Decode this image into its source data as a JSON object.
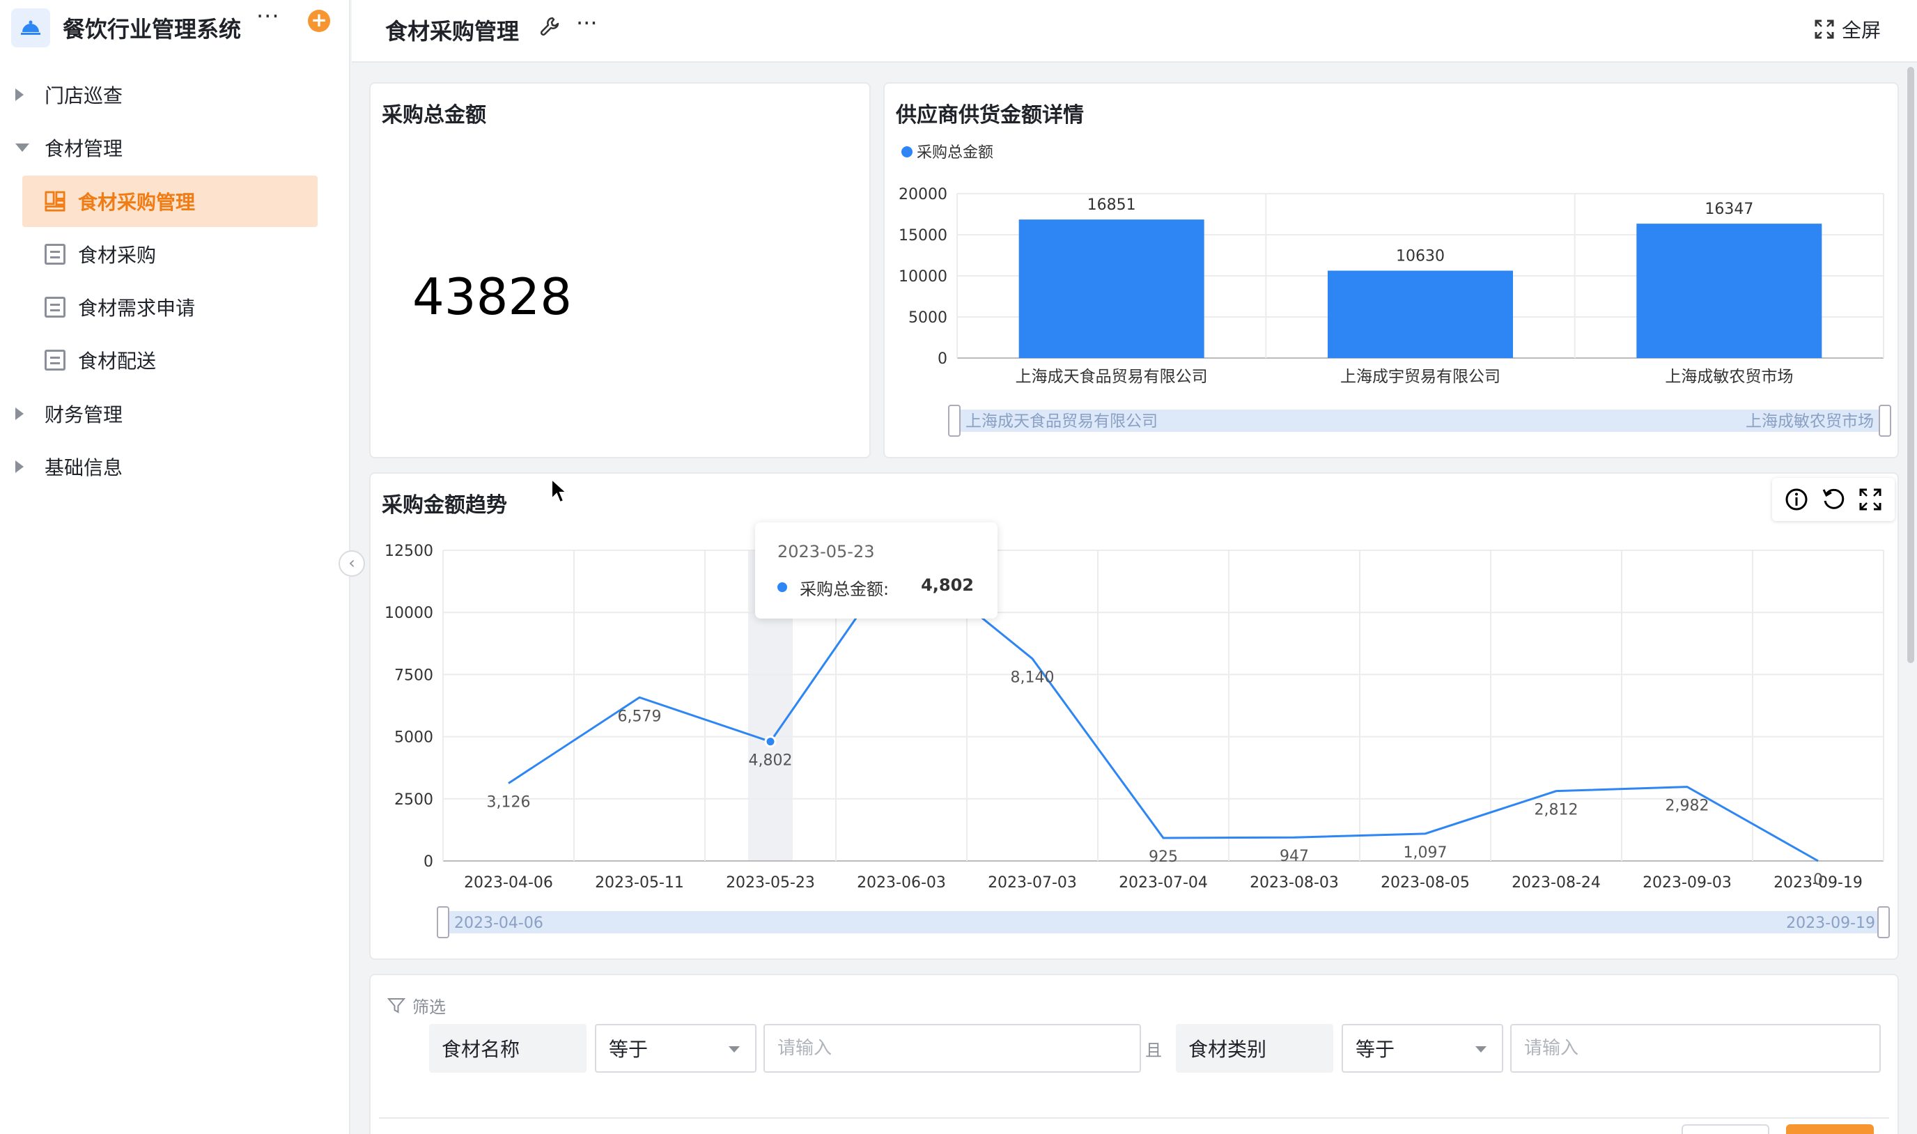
{
  "app": {
    "title": "餐饮行业管理系统",
    "more": "···",
    "add": "+"
  },
  "sidebar": {
    "items": [
      {
        "label": "门店巡查",
        "expanded": false
      },
      {
        "label": "食材管理",
        "expanded": true
      },
      {
        "label": "财务管理",
        "expanded": false
      },
      {
        "label": "基础信息",
        "expanded": false
      }
    ],
    "sub_items": [
      {
        "label": "食材采购管理",
        "active": true
      },
      {
        "label": "食材采购",
        "active": false
      },
      {
        "label": "食材需求申请",
        "active": false
      },
      {
        "label": "食材配送",
        "active": false
      }
    ],
    "collapse": "‹"
  },
  "header": {
    "title": "食材采购管理",
    "more": "···",
    "fullscreen_label": "全屏"
  },
  "total_card": {
    "title": "采购总金额",
    "value": "43828"
  },
  "supplier_card": {
    "title": "供应商供货金额详情"
  },
  "trend_card": {
    "title": "采购金额趋势"
  },
  "tooltip": {
    "date": "2023-05-23",
    "label": "采购总金额:",
    "value": "4,802"
  },
  "filter": {
    "title": "筛选",
    "field1": "食材名称",
    "op1": "等于",
    "input1_placeholder": "请输入",
    "conj": "且",
    "field2": "食材类别",
    "op2": "等于",
    "input2_placeholder": "请输入"
  },
  "colors": {
    "accent": "#f07c15",
    "bar": "#2e86f5",
    "line": "#2e86f5"
  },
  "chart_data": [
    {
      "type": "bar",
      "title": "供应商供货金额详情",
      "legend": "采购总金额",
      "legend_position": "top-left",
      "categories": [
        "上海成天食品贸易有限公司",
        "上海成宇贸易有限公司",
        "上海成敏农贸市场"
      ],
      "values": [
        16851,
        10630,
        16347
      ],
      "value_labels": [
        "16851",
        "10630",
        "16347"
      ],
      "yticks": [
        "0",
        "5000",
        "10000",
        "15000",
        "20000"
      ],
      "ylim": [
        0,
        20000
      ],
      "grid": true,
      "slider_start": "上海成天食品贸易有限公司",
      "slider_end": "上海成敏农贸市场"
    },
    {
      "type": "line",
      "title": "采购金额趋势",
      "x": [
        "2023-04-06",
        "2023-05-11",
        "2023-05-23",
        "2023-06-03",
        "2023-07-03",
        "2023-07-04",
        "2023-08-03",
        "2023-08-05",
        "2023-08-24",
        "2023-09-03",
        "2023-09-19"
      ],
      "values": [
        3126,
        6579,
        4802,
        12400,
        8140,
        925,
        947,
        1097,
        2812,
        2982,
        0
      ],
      "value_labels": [
        "3,126",
        "6,579",
        "4,802",
        "",
        "8,140",
        "925",
        "947",
        "1,097",
        "2,812",
        "2,982",
        "0"
      ],
      "yticks": [
        "0",
        "2500",
        "5000",
        "7500",
        "10000",
        "12500"
      ],
      "ylim": [
        0,
        12500
      ],
      "grid": true,
      "highlight_index": 2,
      "slider_start": "2023-04-06",
      "slider_end": "2023-09-19"
    }
  ]
}
